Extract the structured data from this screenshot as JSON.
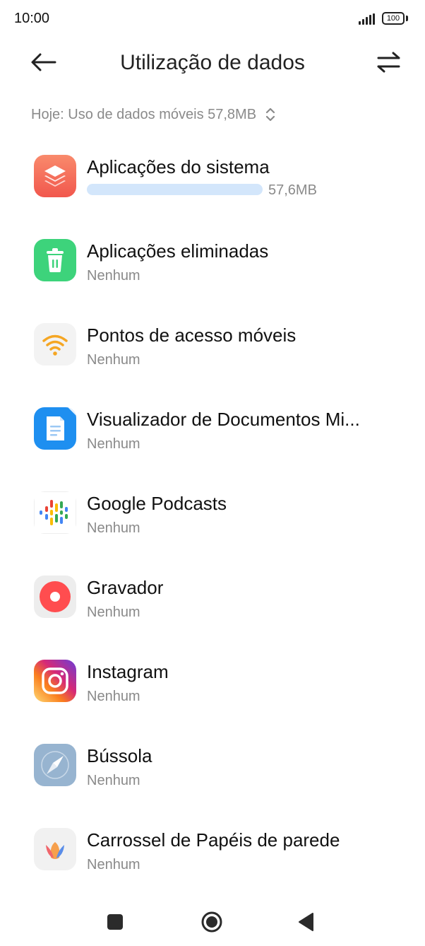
{
  "status_bar": {
    "time": "10:00",
    "battery": "100",
    "icons": [
      "signal-icon",
      "battery-icon"
    ]
  },
  "header": {
    "title": "Utilização de dados",
    "back_icon": "arrow-left-icon",
    "filter_icon": "swap-arrows-icon"
  },
  "summary": {
    "text": "Hoje: Uso de dados móveis 57,8MB",
    "icon": "sort-updown-icon"
  },
  "apps": [
    {
      "name": "Aplicações do sistema",
      "usage": "57,6MB",
      "usage_fraction": 1.0,
      "icon": "system-apps-icon",
      "icon_color": "#f36b5c"
    },
    {
      "name": "Aplicações eliminadas",
      "usage": "Nenhum",
      "icon": "trash-icon",
      "icon_color": "#3dd37b"
    },
    {
      "name": "Pontos de acesso móveis",
      "usage": "Nenhum",
      "icon": "wifi-hotspot-icon",
      "icon_color": "#f5a623"
    },
    {
      "name": "Visualizador de Documentos Mi...",
      "usage": "Nenhum",
      "icon": "document-viewer-icon",
      "icon_color": "#1e8ff0"
    },
    {
      "name": "Google Podcasts",
      "usage": "Nenhum",
      "icon": "google-podcasts-icon"
    },
    {
      "name": "Gravador",
      "usage": "Nenhum",
      "icon": "recorder-icon",
      "icon_color": "#ff4d4f"
    },
    {
      "name": "Instagram",
      "usage": "Nenhum",
      "icon": "instagram-icon"
    },
    {
      "name": "Bússola",
      "usage": "Nenhum",
      "icon": "compass-icon",
      "icon_color": "#97b4d0"
    },
    {
      "name": "Carrossel de Papéis de parede",
      "usage": "Nenhum",
      "icon": "wallpaper-carousel-icon"
    }
  ],
  "nav_bar": {
    "icons": [
      "recents-square-icon",
      "home-circle-icon",
      "back-triangle-icon"
    ]
  }
}
